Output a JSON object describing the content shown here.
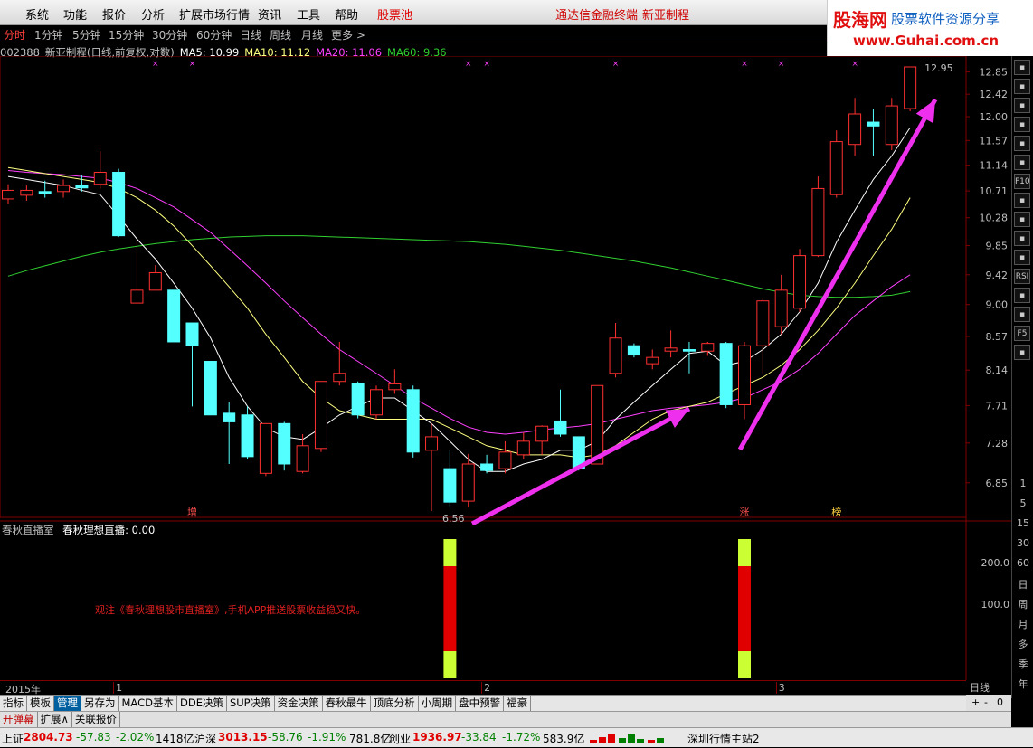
{
  "menu": {
    "items": [
      "系统",
      "功能",
      "报价",
      "分析",
      "扩展市场行情",
      "资讯",
      "工具",
      "帮助"
    ],
    "hot": "股票池",
    "program": "通达信金融终端",
    "stock_name": "新亚制程"
  },
  "logo": {
    "brand": "股海网",
    "slogan": "股票软件资源分享",
    "url": "www.Guhai.com.cn"
  },
  "periods": [
    "分时",
    "1分钟",
    "5分钟",
    "15分钟",
    "30分钟",
    "60分钟",
    "日线",
    "周线",
    "月线",
    "更多 >"
  ],
  "info": {
    "code": "002388",
    "title": "新亚制程(日线,前复权,对数)",
    "ma5": "MA5: 10.99",
    "ma10": "MA10: 11.12",
    "ma20": "MA20: 11.06",
    "ma60": "MA60: 9.36"
  },
  "colors": {
    "up": "#ff3030",
    "down": "#54ffff",
    "ma5": "#ffffff",
    "ma10": "#ffff80",
    "ma20": "#ff40ff",
    "ma60": "#30d030",
    "arrow": "#ee30ee",
    "grid": "#800000"
  },
  "chart_data": {
    "type": "candlestick",
    "ylim": [
      6.56,
      12.95
    ],
    "y_ticks": [
      "12.85",
      "12.42",
      "12.00",
      "11.57",
      "11.14",
      "10.71",
      "10.28",
      "9.85",
      "9.42",
      "9.00",
      "8.57",
      "8.14",
      "7.71",
      "7.28",
      "6.85"
    ],
    "high_label": "12.95",
    "low_label": "6.56",
    "candles": [
      {
        "o": 10.58,
        "c": 10.72,
        "h": 10.82,
        "l": 10.5
      },
      {
        "o": 10.64,
        "c": 10.72,
        "h": 10.8,
        "l": 10.55
      },
      {
        "o": 10.7,
        "c": 10.66,
        "h": 10.88,
        "l": 10.6
      },
      {
        "o": 10.7,
        "c": 10.8,
        "h": 10.9,
        "l": 10.6
      },
      {
        "o": 10.8,
        "c": 10.76,
        "h": 10.98,
        "l": 10.7
      },
      {
        "o": 10.82,
        "c": 11.02,
        "h": 11.38,
        "l": 10.75
      },
      {
        "o": 11.02,
        "c": 10.0,
        "h": 11.08,
        "l": 9.98
      },
      {
        "o": 9.02,
        "c": 9.2,
        "h": 9.95,
        "l": 9.02
      },
      {
        "o": 9.2,
        "c": 9.45,
        "h": 9.56,
        "l": 9.2
      },
      {
        "o": 9.2,
        "c": 8.5,
        "h": 9.2,
        "l": 8.5
      },
      {
        "o": 8.75,
        "c": 8.45,
        "h": 8.75,
        "l": 7.7
      },
      {
        "o": 8.25,
        "c": 7.6,
        "h": 8.25,
        "l": 7.6
      },
      {
        "o": 7.62,
        "c": 7.52,
        "h": 7.75,
        "l": 7.05
      },
      {
        "o": 7.6,
        "c": 7.13,
        "h": 7.7,
        "l": 7.1
      },
      {
        "o": 6.95,
        "c": 7.5,
        "h": 7.5,
        "l": 6.92
      },
      {
        "o": 7.5,
        "c": 7.05,
        "h": 7.52,
        "l": 6.98
      },
      {
        "o": 6.97,
        "c": 7.25,
        "h": 7.38,
        "l": 6.95
      },
      {
        "o": 7.22,
        "c": 8.0,
        "h": 8.0,
        "l": 7.18
      },
      {
        "o": 8.0,
        "c": 8.1,
        "h": 8.5,
        "l": 7.95
      },
      {
        "o": 7.98,
        "c": 7.6,
        "h": 8.0,
        "l": 7.56
      },
      {
        "o": 7.6,
        "c": 7.9,
        "h": 7.95,
        "l": 7.55
      },
      {
        "o": 7.9,
        "c": 7.97,
        "h": 8.15,
        "l": 7.85
      },
      {
        "o": 7.9,
        "c": 7.18,
        "h": 7.95,
        "l": 7.12
      },
      {
        "o": 7.2,
        "c": 7.35,
        "h": 7.5,
        "l": 6.56
      },
      {
        "o": 7.0,
        "c": 6.65,
        "h": 7.2,
        "l": 6.6
      },
      {
        "o": 6.66,
        "c": 7.05,
        "h": 7.16,
        "l": 6.6
      },
      {
        "o": 7.05,
        "c": 6.98,
        "h": 7.15,
        "l": 6.95
      },
      {
        "o": 7.0,
        "c": 7.18,
        "h": 7.3,
        "l": 6.95
      },
      {
        "o": 7.15,
        "c": 7.3,
        "h": 7.4,
        "l": 7.1
      },
      {
        "o": 7.3,
        "c": 7.47,
        "h": 7.48,
        "l": 7.15
      },
      {
        "o": 7.53,
        "c": 7.38,
        "h": 7.9,
        "l": 7.35
      },
      {
        "o": 7.35,
        "c": 7.0,
        "h": 7.35,
        "l": 6.98
      },
      {
        "o": 7.05,
        "c": 7.95,
        "h": 7.95,
        "l": 7.05
      },
      {
        "o": 8.1,
        "c": 8.55,
        "h": 8.75,
        "l": 8.05
      },
      {
        "o": 8.45,
        "c": 8.33,
        "h": 8.48,
        "l": 8.3
      },
      {
        "o": 8.22,
        "c": 8.3,
        "h": 8.4,
        "l": 8.15
      },
      {
        "o": 8.38,
        "c": 8.42,
        "h": 8.65,
        "l": 8.3
      },
      {
        "o": 8.4,
        "c": 8.38,
        "h": 8.5,
        "l": 8.1
      },
      {
        "o": 8.38,
        "c": 8.48,
        "h": 8.5,
        "l": 8.32
      },
      {
        "o": 8.48,
        "c": 7.72,
        "h": 8.5,
        "l": 7.68
      },
      {
        "o": 7.72,
        "c": 8.45,
        "h": 8.5,
        "l": 7.55
      },
      {
        "o": 8.45,
        "c": 9.05,
        "h": 9.08,
        "l": 8.1
      },
      {
        "o": 8.7,
        "c": 9.2,
        "h": 9.42,
        "l": 8.6
      },
      {
        "o": 8.95,
        "c": 9.7,
        "h": 9.8,
        "l": 8.9
      },
      {
        "o": 9.7,
        "c": 10.75,
        "h": 10.95,
        "l": 9.68
      },
      {
        "o": 10.65,
        "c": 11.55,
        "h": 11.75,
        "l": 10.6
      },
      {
        "o": 11.5,
        "c": 12.05,
        "h": 12.35,
        "l": 11.3
      },
      {
        "o": 11.9,
        "c": 11.83,
        "h": 12.15,
        "l": 11.3
      },
      {
        "o": 11.5,
        "c": 12.2,
        "h": 12.35,
        "l": 11.4
      },
      {
        "o": 12.15,
        "c": 12.95,
        "h": 12.95,
        "l": 12.1
      }
    ],
    "ma5": [
      10.95,
      10.9,
      10.85,
      10.8,
      10.72,
      10.65,
      10.3,
      9.95,
      9.65,
      9.3,
      8.95,
      8.55,
      8.05,
      7.7,
      7.45,
      7.35,
      7.32,
      7.45,
      7.6,
      7.7,
      7.8,
      7.8,
      7.65,
      7.5,
      7.3,
      7.1,
      6.97,
      6.97,
      7.05,
      7.1,
      7.2,
      7.2,
      7.3,
      7.55,
      7.75,
      7.95,
      8.15,
      8.35,
      8.38,
      8.2,
      8.25,
      8.4,
      8.6,
      8.9,
      9.3,
      9.9,
      10.4,
      10.9,
      11.3,
      11.8
    ],
    "ma10": [
      11.1,
      11.05,
      11.0,
      10.95,
      10.9,
      10.85,
      10.75,
      10.6,
      10.4,
      10.15,
      9.85,
      9.55,
      9.25,
      8.95,
      8.6,
      8.3,
      8.0,
      7.8,
      7.65,
      7.6,
      7.55,
      7.55,
      7.55,
      7.55,
      7.45,
      7.35,
      7.25,
      7.2,
      7.15,
      7.15,
      7.15,
      7.12,
      7.15,
      7.25,
      7.4,
      7.55,
      7.65,
      7.7,
      7.75,
      7.85,
      7.95,
      8.05,
      8.2,
      8.4,
      8.65,
      8.95,
      9.3,
      9.7,
      10.1,
      10.6
    ],
    "ma20": [
      11.05,
      11.02,
      11.0,
      10.98,
      10.95,
      10.92,
      10.85,
      10.75,
      10.6,
      10.45,
      10.25,
      10.05,
      9.8,
      9.55,
      9.3,
      9.05,
      8.82,
      8.6,
      8.4,
      8.25,
      8.1,
      7.95,
      7.8,
      7.68,
      7.56,
      7.46,
      7.4,
      7.38,
      7.4,
      7.43,
      7.45,
      7.47,
      7.5,
      7.55,
      7.6,
      7.65,
      7.68,
      7.7,
      7.72,
      7.75,
      7.8,
      7.9,
      8.0,
      8.15,
      8.35,
      8.6,
      8.85,
      9.05,
      9.25,
      9.42
    ],
    "ma60": [
      9.4,
      9.48,
      9.55,
      9.62,
      9.69,
      9.75,
      9.8,
      9.84,
      9.88,
      9.91,
      9.94,
      9.96,
      9.98,
      9.99,
      10.0,
      10.0,
      10.0,
      9.99,
      9.98,
      9.97,
      9.96,
      9.95,
      9.94,
      9.93,
      9.92,
      9.91,
      9.89,
      9.87,
      9.84,
      9.81,
      9.78,
      9.74,
      9.7,
      9.66,
      9.62,
      9.57,
      9.52,
      9.46,
      9.4,
      9.34,
      9.28,
      9.22,
      9.17,
      9.13,
      9.11,
      9.1,
      9.1,
      9.11,
      9.13,
      9.18
    ],
    "markers": [
      {
        "i": 10,
        "text": "增",
        "color": "#ff5050"
      },
      {
        "i": 40,
        "text": "涨",
        "color": "#ff5050"
      },
      {
        "i": 45,
        "text": "榜",
        "color": "#ffd040"
      }
    ],
    "sub": {
      "title": "春秋直播室",
      "indicator": "春秋理想直播: 0.00",
      "ticks": [
        "200.0",
        "100.0"
      ],
      "bars": [
        24,
        40
      ],
      "message": "观注《春秋理想股市直播室》,手机APP推送股票收益稳又快。"
    },
    "dates": {
      "year": "2015年",
      "months": [
        {
          "i": 6,
          "t": "1"
        },
        {
          "i": 26,
          "t": "2"
        },
        {
          "i": 42,
          "t": "3"
        }
      ]
    }
  },
  "right_tools": {
    "digits": [
      "1",
      "5",
      "15",
      "30",
      "60"
    ],
    "chars": [
      "日",
      "周",
      "月",
      "多",
      "季",
      "年"
    ],
    "btns": [
      "RSI",
      "F10",
      "F5"
    ]
  },
  "daily_label": "日线",
  "bottom_tabs": [
    "指标",
    "模板",
    "管理",
    "另存为",
    "MACD基本",
    "DDE决策",
    "SUP决策",
    "资金决策",
    "春秋最牛",
    "顶底分析",
    "小周期",
    "盘中预警",
    "福豪"
  ],
  "extra_tabs": [
    "开弹幕",
    "扩展∧",
    "关联报价"
  ],
  "status": {
    "sh_label": "上证",
    "sh_val": "2804.73",
    "sh_chg": "-57.83",
    "sh_pct": "-2.02%",
    "sh_amt": "1418亿",
    "hs_label": "沪深",
    "hs_val": "3013.15",
    "hs_chg": "-58.76",
    "hs_pct": "-1.91%",
    "hs_amt": "781.8亿",
    "cy_label": "创业",
    "cy_val": "1936.97",
    "cy_chg": "-33.84",
    "cy_pct": "-1.72%",
    "cy_amt": "583.9亿",
    "server": "深圳行情主站2"
  }
}
